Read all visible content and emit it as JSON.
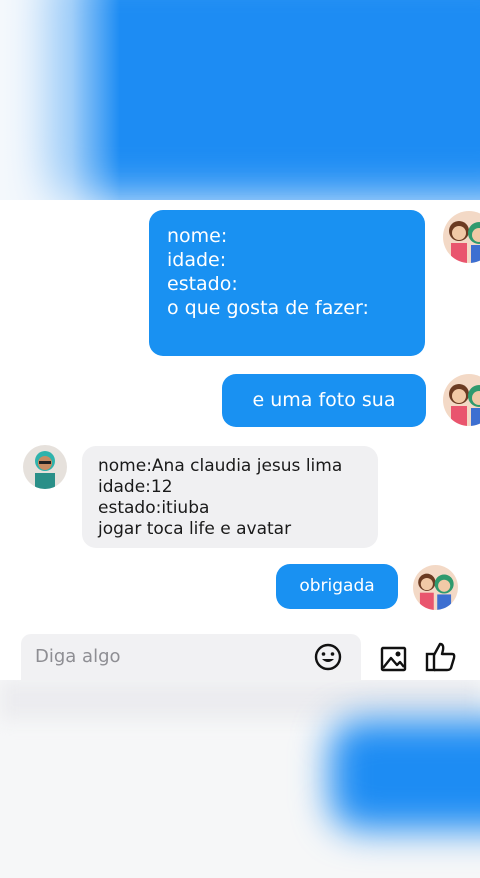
{
  "messages": {
    "form_request": "nome:\nidade:\nestado:\no que gosta de fazer:",
    "photo_request": "e uma foto sua",
    "reply": "nome:Ana claudia jesus lima\nidade:12\nestado:itiuba\njogar toca life e avatar",
    "thanks": "obrigada"
  },
  "composer": {
    "placeholder": "Diga algo"
  },
  "icons": {
    "emoji": "smiley-icon",
    "image": "image-icon",
    "like": "thumbs-up-icon"
  },
  "colors": {
    "outgoing_bubble": "#1991f2",
    "incoming_bubble": "#f0f0f2"
  }
}
